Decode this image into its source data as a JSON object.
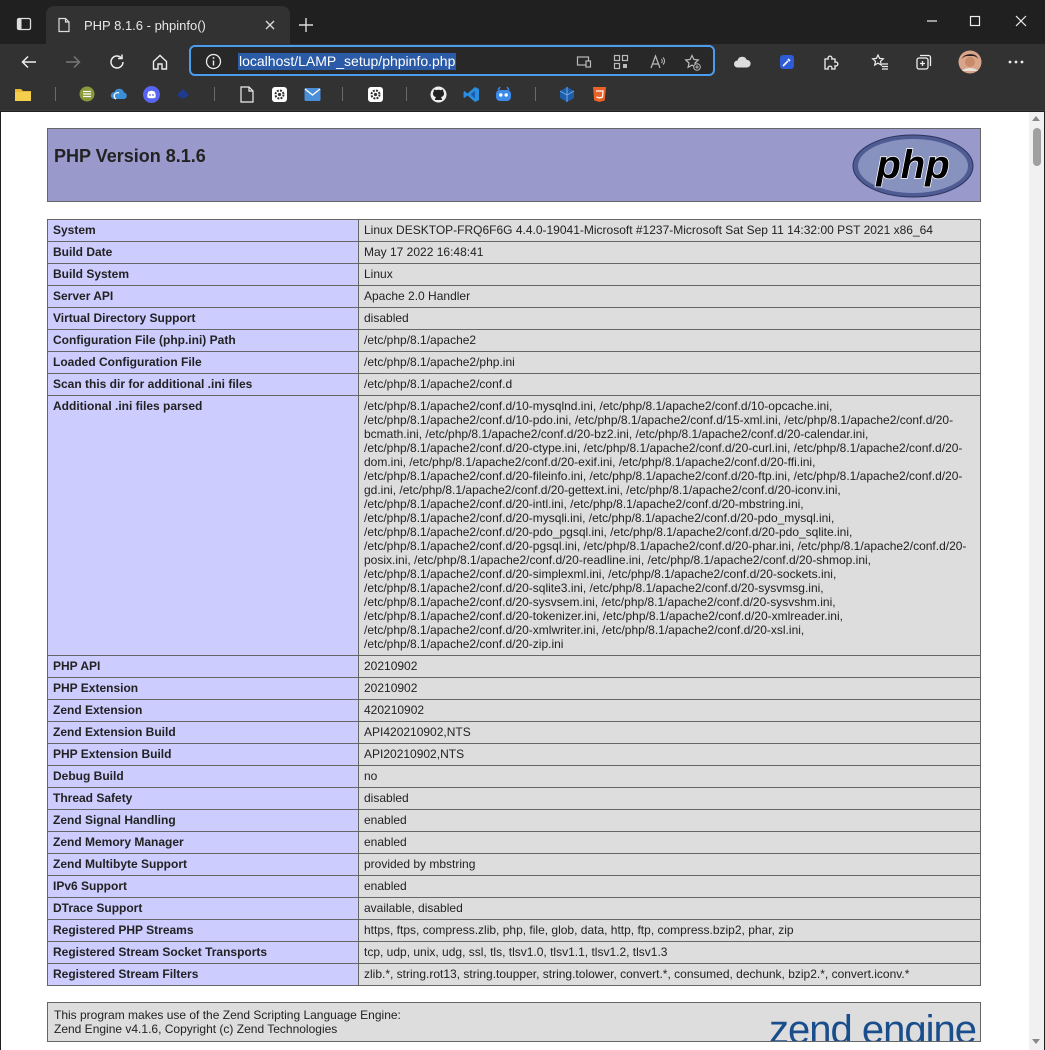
{
  "browser": {
    "tab_title": "PHP 8.1.6 - phpinfo()",
    "url": "localhost/LAMP_setup/phpinfo.php"
  },
  "page": {
    "heading": "PHP Version 8.1.6",
    "logo_text": "php",
    "rows": [
      {
        "label": "System",
        "value": "Linux DESKTOP-FRQ6F6G 4.4.0-19041-Microsoft #1237-Microsoft Sat Sep 11 14:32:00 PST 2021 x86_64"
      },
      {
        "label": "Build Date",
        "value": "May 17 2022 16:48:41"
      },
      {
        "label": "Build System",
        "value": "Linux"
      },
      {
        "label": "Server API",
        "value": "Apache 2.0 Handler"
      },
      {
        "label": "Virtual Directory Support",
        "value": "disabled"
      },
      {
        "label": "Configuration File (php.ini) Path",
        "value": "/etc/php/8.1/apache2"
      },
      {
        "label": "Loaded Configuration File",
        "value": "/etc/php/8.1/apache2/php.ini"
      },
      {
        "label": "Scan this dir for additional .ini files",
        "value": "/etc/php/8.1/apache2/conf.d"
      }
    ],
    "ini_parsed": {
      "label": "Additional .ini files parsed",
      "lines": [
        "/etc/php/8.1/apache2/conf.d/10-mysqlnd.ini, /etc/php/8.1/apache2/conf.d/10-opcache.ini,",
        "/etc/php/8.1/apache2/conf.d/10-pdo.ini, /etc/php/8.1/apache2/conf.d/15-xml.ini, /etc/php/8.1/apache2/conf.d/20-",
        "bcmath.ini, /etc/php/8.1/apache2/conf.d/20-bz2.ini, /etc/php/8.1/apache2/conf.d/20-calendar.ini,",
        "/etc/php/8.1/apache2/conf.d/20-ctype.ini, /etc/php/8.1/apache2/conf.d/20-curl.ini, /etc/php/8.1/apache2/conf.d/20-",
        "dom.ini, /etc/php/8.1/apache2/conf.d/20-exif.ini, /etc/php/8.1/apache2/conf.d/20-ffi.ini,",
        "/etc/php/8.1/apache2/conf.d/20-fileinfo.ini, /etc/php/8.1/apache2/conf.d/20-ftp.ini, /etc/php/8.1/apache2/conf.d/20-",
        "gd.ini, /etc/php/8.1/apache2/conf.d/20-gettext.ini, /etc/php/8.1/apache2/conf.d/20-iconv.ini,",
        "/etc/php/8.1/apache2/conf.d/20-intl.ini, /etc/php/8.1/apache2/conf.d/20-mbstring.ini,",
        "/etc/php/8.1/apache2/conf.d/20-mysqli.ini, /etc/php/8.1/apache2/conf.d/20-pdo_mysql.ini,",
        "/etc/php/8.1/apache2/conf.d/20-pdo_pgsql.ini, /etc/php/8.1/apache2/conf.d/20-pdo_sqlite.ini,",
        "/etc/php/8.1/apache2/conf.d/20-pgsql.ini, /etc/php/8.1/apache2/conf.d/20-phar.ini, /etc/php/8.1/apache2/conf.d/20-",
        "posix.ini, /etc/php/8.1/apache2/conf.d/20-readline.ini, /etc/php/8.1/apache2/conf.d/20-shmop.ini,",
        "/etc/php/8.1/apache2/conf.d/20-simplexml.ini, /etc/php/8.1/apache2/conf.d/20-sockets.ini,",
        "/etc/php/8.1/apache2/conf.d/20-sqlite3.ini, /etc/php/8.1/apache2/conf.d/20-sysvmsg.ini,",
        "/etc/php/8.1/apache2/conf.d/20-sysvsem.ini, /etc/php/8.1/apache2/conf.d/20-sysvshm.ini,",
        "/etc/php/8.1/apache2/conf.d/20-tokenizer.ini, /etc/php/8.1/apache2/conf.d/20-xmlreader.ini,",
        "/etc/php/8.1/apache2/conf.d/20-xmlwriter.ini, /etc/php/8.1/apache2/conf.d/20-xsl.ini,",
        "/etc/php/8.1/apache2/conf.d/20-zip.ini"
      ]
    },
    "rows2": [
      {
        "label": "PHP API",
        "value": "20210902"
      },
      {
        "label": "PHP Extension",
        "value": "20210902"
      },
      {
        "label": "Zend Extension",
        "value": "420210902"
      },
      {
        "label": "Zend Extension Build",
        "value": "API420210902,NTS"
      },
      {
        "label": "PHP Extension Build",
        "value": "API20210902,NTS"
      },
      {
        "label": "Debug Build",
        "value": "no"
      },
      {
        "label": "Thread Safety",
        "value": "disabled"
      },
      {
        "label": "Zend Signal Handling",
        "value": "enabled"
      },
      {
        "label": "Zend Memory Manager",
        "value": "enabled"
      },
      {
        "label": "Zend Multibyte Support",
        "value": "provided by mbstring"
      },
      {
        "label": "IPv6 Support",
        "value": "enabled"
      },
      {
        "label": "DTrace Support",
        "value": "available, disabled"
      },
      {
        "label": "Registered PHP Streams",
        "value": "https, ftps, compress.zlib, php, file, glob, data, http, ftp, compress.bzip2, phar, zip"
      },
      {
        "label": "Registered Stream Socket Transports",
        "value": "tcp, udp, unix, udg, ssl, tls, tlsv1.0, tlsv1.1, tlsv1.2, tlsv1.3"
      },
      {
        "label": "Registered Stream Filters",
        "value": "zlib.*, string.rot13, string.toupper, string.tolower, convert.*, consumed, dechunk, bzip2.*, convert.iconv.*"
      }
    ],
    "footer": {
      "line1": "This program makes use of the Zend Scripting Language Engine:",
      "line2": "Zend Engine v4.1.6, Copyright (c) Zend Technologies",
      "logo_text": "zend engine"
    }
  },
  "colors": {
    "header_bg": "#9999cc",
    "label_bg": "#ccccff",
    "value_bg": "#dddddd",
    "address_focus": "#4c9cee"
  }
}
